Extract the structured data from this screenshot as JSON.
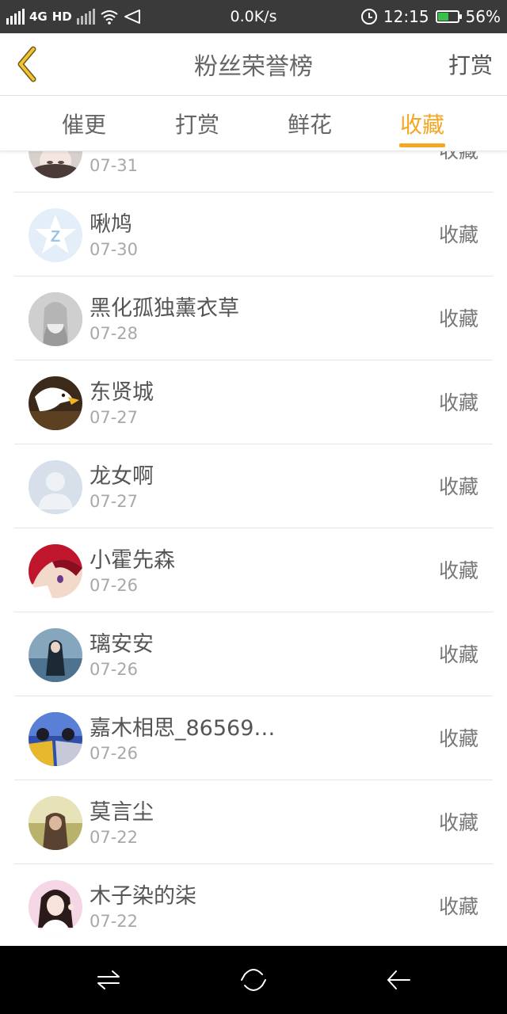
{
  "status_bar": {
    "network": "4G",
    "hd": "HD",
    "speed": "0.0K/s",
    "time": "12:15",
    "battery_percent": "56%",
    "battery_level": 0.56,
    "icons": [
      "signal-icon",
      "signal-weak-icon",
      "wifi-icon",
      "send-icon",
      "alarm-icon",
      "battery-icon"
    ]
  },
  "header": {
    "title": "粉丝荣誉榜",
    "action": "打赏",
    "back_icon": "chevron-left-icon",
    "accent_color": "#f5a623"
  },
  "tabs": [
    {
      "label": "催更",
      "active": false
    },
    {
      "label": "打赏",
      "active": false
    },
    {
      "label": "鲜花",
      "active": false
    },
    {
      "label": "收藏",
      "active": true
    }
  ],
  "list": {
    "items": [
      {
        "name": "",
        "date": "07-31",
        "action": "收藏",
        "avatar": "avatar-girl-face"
      },
      {
        "name": "啾鸠",
        "date": "07-30",
        "action": "收藏",
        "avatar": "avatar-qq-star"
      },
      {
        "name": "黑化孤独薰衣草",
        "date": "07-28",
        "action": "收藏",
        "avatar": "avatar-gray-hair"
      },
      {
        "name": "东贤城",
        "date": "07-27",
        "action": "收藏",
        "avatar": "avatar-eagle"
      },
      {
        "name": "龙女啊",
        "date": "07-27",
        "action": "收藏",
        "avatar": "avatar-default-person"
      },
      {
        "name": "小霍先森",
        "date": "07-26",
        "action": "收藏",
        "avatar": "avatar-red-hair-anime"
      },
      {
        "name": "璃安安",
        "date": "07-26",
        "action": "收藏",
        "avatar": "avatar-girl-sea"
      },
      {
        "name": "嘉木相思_86569…",
        "date": "07-26",
        "action": "收藏",
        "avatar": "avatar-couple"
      },
      {
        "name": "莫言尘",
        "date": "07-22",
        "action": "收藏",
        "avatar": "avatar-girl-forest"
      },
      {
        "name": "木子染的柒",
        "date": "07-22",
        "action": "收藏",
        "avatar": "avatar-girl-pink"
      }
    ]
  },
  "nav_bar": {
    "icons": [
      "switch-apps-icon",
      "home-icon",
      "back-arrow-icon"
    ]
  }
}
